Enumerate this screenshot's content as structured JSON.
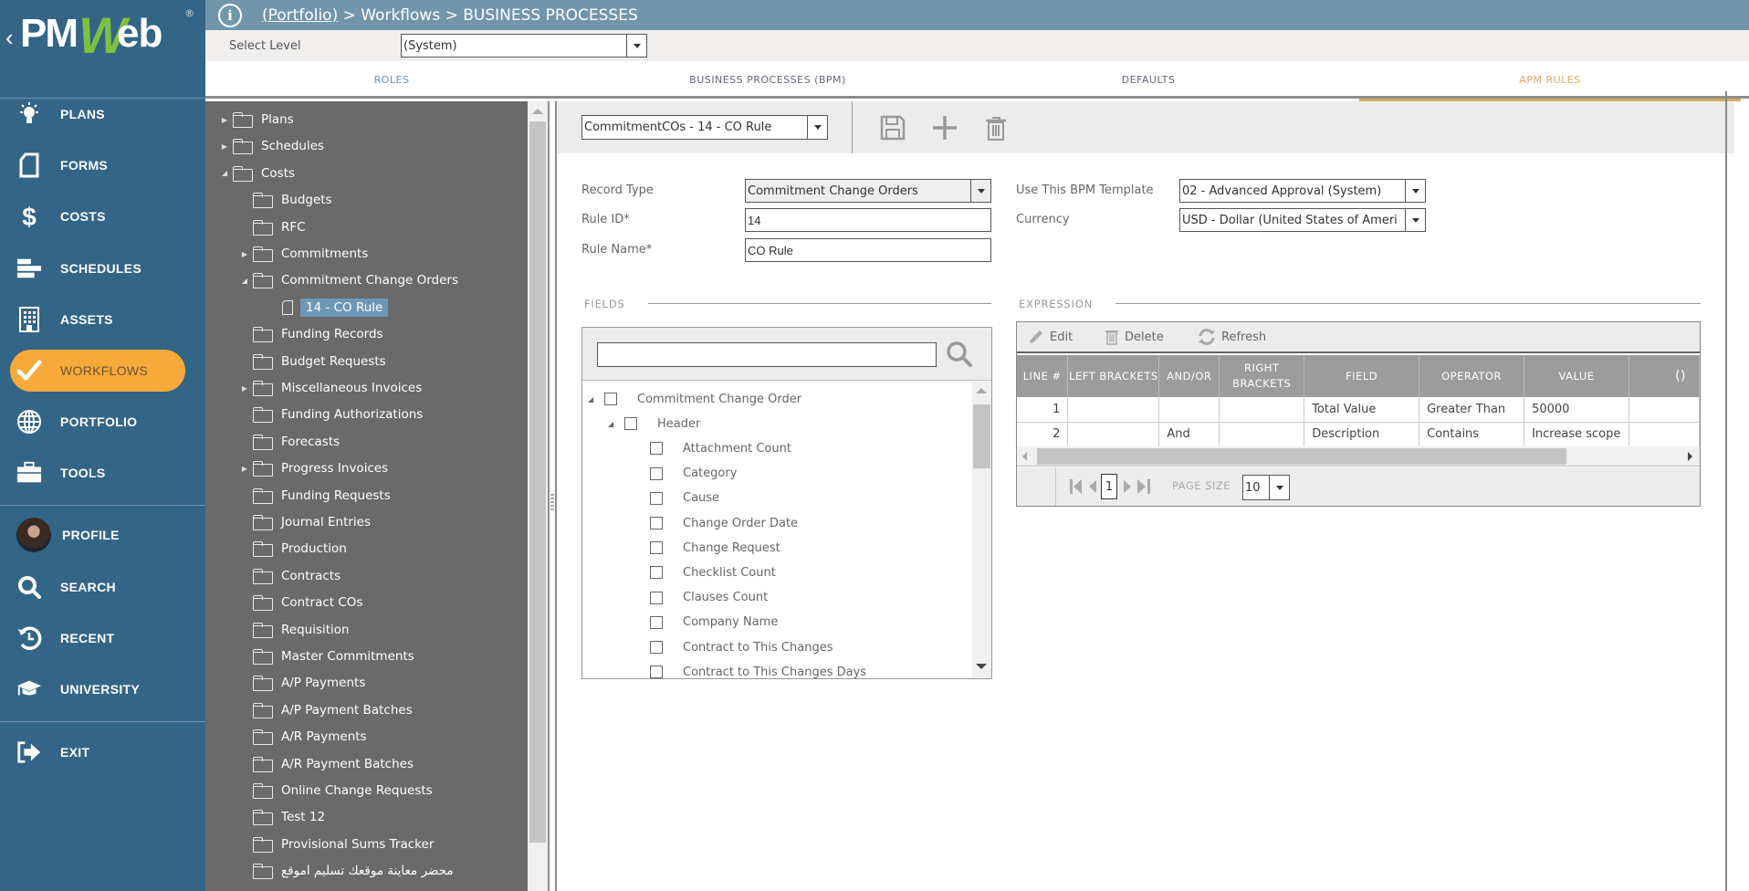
{
  "logo": {
    "text_pm": "PM",
    "text_w": "W",
    "text_eb": "eb",
    "back_glyph": "‹",
    "registered": "®"
  },
  "sidebar": {
    "items": [
      {
        "label": "PLANS",
        "icon": "lightbulb-icon"
      },
      {
        "label": "FORMS",
        "icon": "document-icon"
      },
      {
        "label": "COSTS",
        "icon": "dollar-icon"
      },
      {
        "label": "SCHEDULES",
        "icon": "gantt-icon"
      },
      {
        "label": "ASSETS",
        "icon": "building-icon"
      },
      {
        "label": "WORKFLOWS",
        "icon": "checkmark-icon",
        "active": true
      },
      {
        "label": "PORTFOLIO",
        "icon": "globe-icon"
      },
      {
        "label": "TOOLS",
        "icon": "toolbox-icon"
      }
    ],
    "bottom_items": [
      {
        "label": "PROFILE",
        "icon": "avatar"
      },
      {
        "label": "SEARCH",
        "icon": "search-icon"
      },
      {
        "label": "RECENT",
        "icon": "history-icon"
      },
      {
        "label": "UNIVERSITY",
        "icon": "graduation-cap-icon"
      }
    ],
    "exit": {
      "label": "EXIT",
      "icon": "exit-icon"
    }
  },
  "header": {
    "info_glyph": "i",
    "breadcrumb_link": "(Portfolio)",
    "breadcrumb_rest": " > Workflows > BUSINESS PROCESSES"
  },
  "level": {
    "label": "Select Level",
    "value": "(System)"
  },
  "tabs": [
    {
      "label": "ROLES"
    },
    {
      "label": "BUSINESS PROCESSES (BPM)"
    },
    {
      "label": "DEFAULTS"
    },
    {
      "label": "APM RULES",
      "active": true
    }
  ],
  "tree": {
    "items": [
      {
        "label": "Plans",
        "level": 0,
        "expander": "collapsed",
        "type": "folder"
      },
      {
        "label": "Schedules",
        "level": 0,
        "expander": "collapsed",
        "type": "folder"
      },
      {
        "label": "Costs",
        "level": 0,
        "expander": "expanded",
        "type": "folder"
      },
      {
        "label": "Budgets",
        "level": 1,
        "expander": "none",
        "type": "folder"
      },
      {
        "label": "RFC",
        "level": 1,
        "expander": "none",
        "type": "folder"
      },
      {
        "label": "Commitments",
        "level": 1,
        "expander": "collapsed",
        "type": "folder"
      },
      {
        "label": "Commitment Change Orders",
        "level": 1,
        "expander": "expanded",
        "type": "folder"
      },
      {
        "label": "14 - CO Rule",
        "level": 2,
        "expander": "none",
        "type": "doc",
        "selected": true
      },
      {
        "label": "Funding Records",
        "level": 1,
        "expander": "none",
        "type": "folder"
      },
      {
        "label": "Budget Requests",
        "level": 1,
        "expander": "none",
        "type": "folder"
      },
      {
        "label": "Miscellaneous Invoices",
        "level": 1,
        "expander": "collapsed",
        "type": "folder"
      },
      {
        "label": "Funding Authorizations",
        "level": 1,
        "expander": "none",
        "type": "folder"
      },
      {
        "label": "Forecasts",
        "level": 1,
        "expander": "none",
        "type": "folder"
      },
      {
        "label": "Progress Invoices",
        "level": 1,
        "expander": "collapsed",
        "type": "folder"
      },
      {
        "label": "Funding Requests",
        "level": 1,
        "expander": "none",
        "type": "folder"
      },
      {
        "label": "Journal Entries",
        "level": 1,
        "expander": "none",
        "type": "folder"
      },
      {
        "label": "Production",
        "level": 1,
        "expander": "none",
        "type": "folder"
      },
      {
        "label": "Contracts",
        "level": 1,
        "expander": "none",
        "type": "folder"
      },
      {
        "label": "Contract COs",
        "level": 1,
        "expander": "none",
        "type": "folder"
      },
      {
        "label": "Requisition",
        "level": 1,
        "expander": "none",
        "type": "folder"
      },
      {
        "label": "Master Commitments",
        "level": 1,
        "expander": "none",
        "type": "folder"
      },
      {
        "label": "A/P Payments",
        "level": 1,
        "expander": "none",
        "type": "folder"
      },
      {
        "label": "A/P Payment Batches",
        "level": 1,
        "expander": "none",
        "type": "folder"
      },
      {
        "label": "A/R Payments",
        "level": 1,
        "expander": "none",
        "type": "folder"
      },
      {
        "label": "A/R Payment Batches",
        "level": 1,
        "expander": "none",
        "type": "folder"
      },
      {
        "label": "Online Change Requests",
        "level": 1,
        "expander": "none",
        "type": "folder"
      },
      {
        "label": "Test 12",
        "level": 1,
        "expander": "none",
        "type": "folder"
      },
      {
        "label": "Provisional Sums Tracker",
        "level": 1,
        "expander": "none",
        "type": "folder"
      },
      {
        "label": "محضر معاينة موقعك تسليم اموقع",
        "level": 1,
        "expander": "none",
        "type": "folder"
      }
    ]
  },
  "toolbar": {
    "rule_select": "CommitmentCOs - 14 - CO Rule",
    "icons": [
      "save-icon",
      "add-icon",
      "delete-icon"
    ]
  },
  "form": {
    "record_type": {
      "label": "Record Type",
      "value": "Commitment Change Orders"
    },
    "rule_id": {
      "label": "Rule ID*",
      "value": "14"
    },
    "rule_name": {
      "label": "Rule Name*",
      "value": "CO Rule"
    },
    "bpm_template": {
      "label": "Use This BPM Template",
      "value": "02 - Advanced Approval (System)"
    },
    "currency": {
      "label": "Currency",
      "value": "USD - Dollar (United States of Ameri"
    }
  },
  "fields": {
    "title": "FIELDS",
    "search_value": "",
    "items": [
      {
        "label": "Commitment Change Order",
        "level": 0,
        "expander": "expanded"
      },
      {
        "label": "Header",
        "level": 1,
        "expander": "expanded"
      },
      {
        "label": "Attachment Count",
        "level": 2
      },
      {
        "label": "Category",
        "level": 2
      },
      {
        "label": "Cause",
        "level": 2
      },
      {
        "label": "Change Order Date",
        "level": 2
      },
      {
        "label": "Change Request",
        "level": 2
      },
      {
        "label": "Checklist Count",
        "level": 2
      },
      {
        "label": "Clauses Count",
        "level": 2
      },
      {
        "label": "Company Name",
        "level": 2
      },
      {
        "label": "Contract to This Changes",
        "level": 2
      },
      {
        "label": "Contract to This Changes Days",
        "level": 2
      }
    ]
  },
  "expression": {
    "title": "EXPRESSION",
    "actions": {
      "edit": "Edit",
      "delete": "Delete",
      "refresh": "Refresh"
    },
    "columns": [
      "LINE #",
      "LEFT BRACKETS",
      "AND/OR",
      "RIGHT BRACKETS",
      "FIELD",
      "OPERATOR",
      "VALUE",
      "()"
    ],
    "rows": [
      {
        "line": "1",
        "left": "",
        "andor": "",
        "right": "",
        "field": "Total Value",
        "operator": "Greater Than",
        "value": "50000",
        "paren": ""
      },
      {
        "line": "2",
        "left": "",
        "andor": "And",
        "right": "",
        "field": "Description",
        "operator": "Contains",
        "value": "Increase scope",
        "paren": ""
      }
    ],
    "pager": {
      "page": "1",
      "page_size_label": "PAGE SIZE",
      "page_size": "10"
    }
  },
  "colors": {
    "sidebar_bg": "#336587",
    "header_bg": "#7196ab",
    "active_pill": "#f7a93a",
    "active_tab": "#e8a766",
    "tree_bg": "#6a6a6a",
    "tree_selected": "#6e97b6",
    "grid_header": "#9c9c9c"
  }
}
